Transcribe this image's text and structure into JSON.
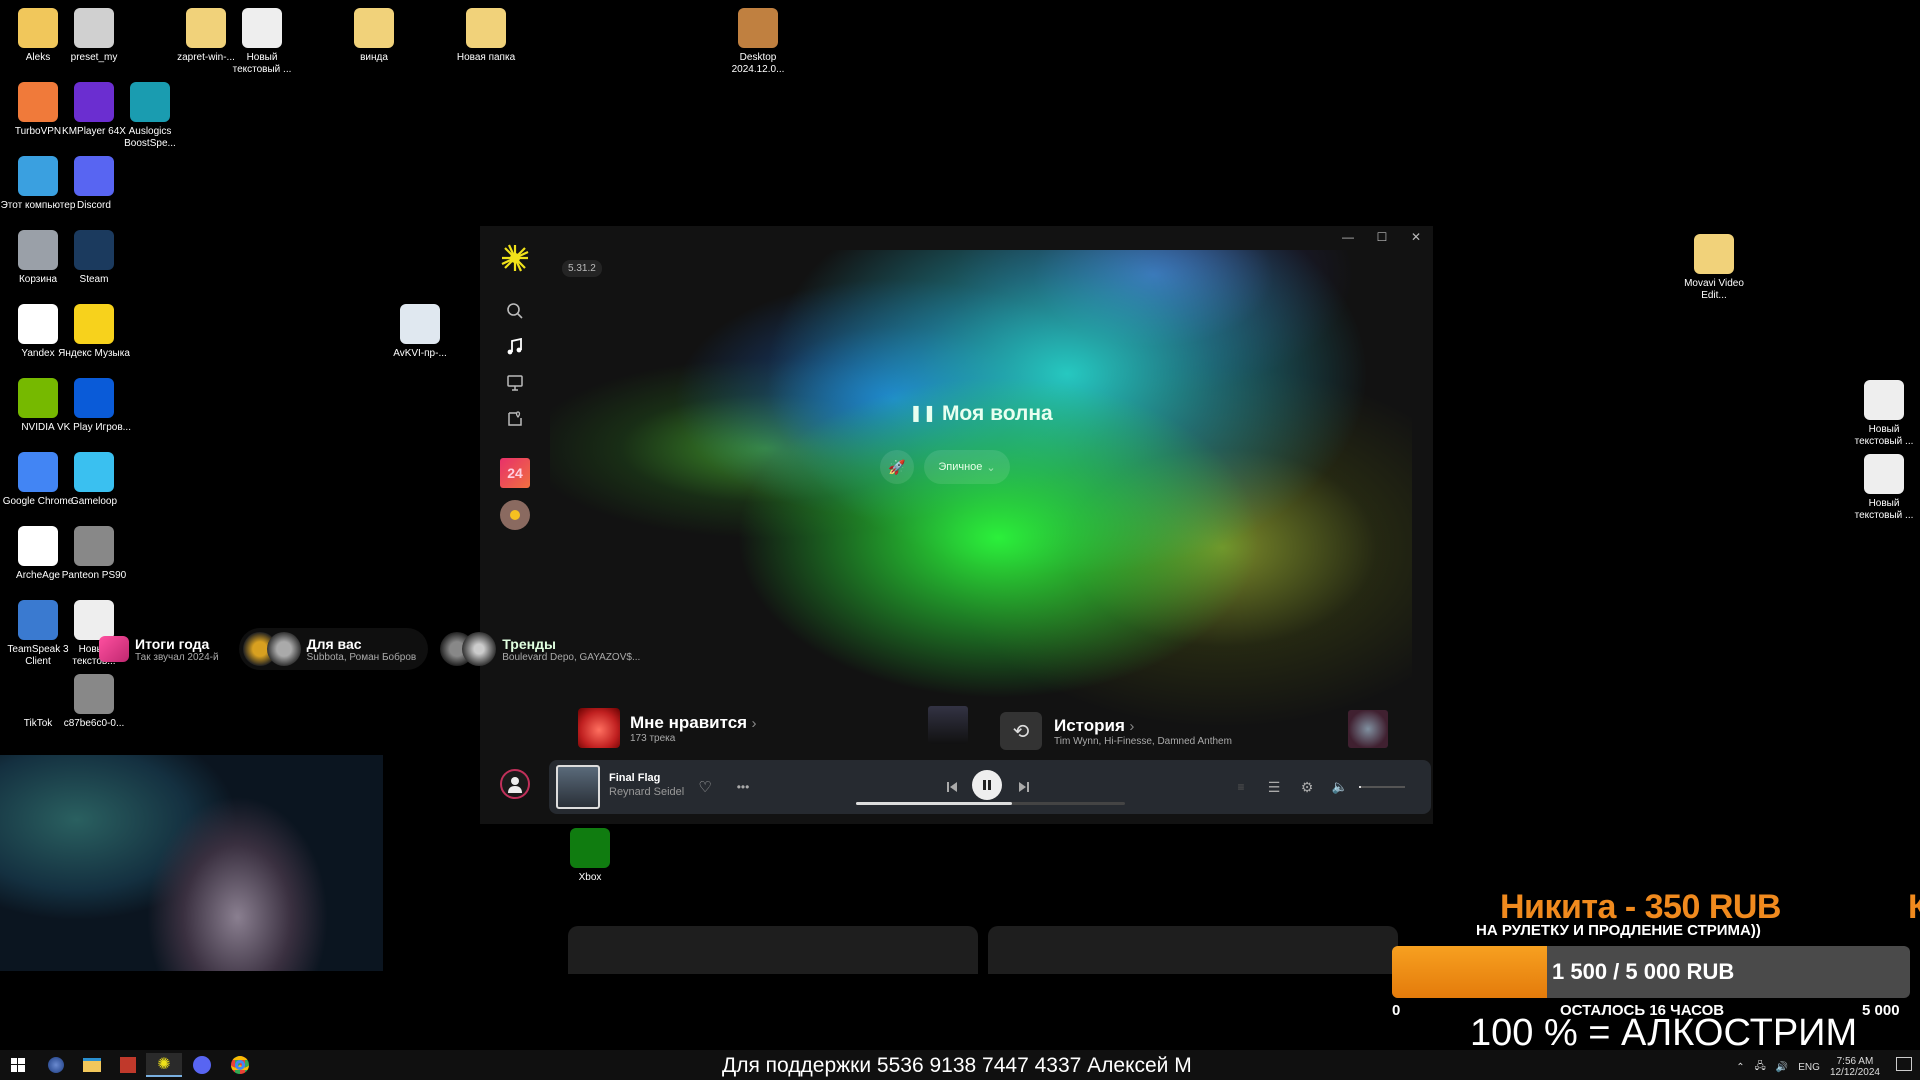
{
  "desktop_icons": [
    {
      "label": "Aleks",
      "icon": "user-folder-icon",
      "color": "#f1c75b"
    },
    {
      "label": "preset_my",
      "icon": "settings-file-icon",
      "color": "#d0d0d0"
    },
    {
      "label": "zapret-win-...",
      "icon": "folder-icon",
      "color": "#f1d27a"
    },
    {
      "label": "Новый текстовый ...",
      "icon": "text-file-icon",
      "color": "#eeeeee"
    },
    {
      "label": "винда",
      "icon": "folder-icon",
      "color": "#f1d27a"
    },
    {
      "label": "Новая папка",
      "icon": "folder-icon",
      "color": "#f1d27a"
    },
    {
      "label": "Desktop 2024.12.0...",
      "icon": "video-file-icon",
      "color": "#c08040"
    },
    {
      "label": "TurboVPN",
      "icon": "turbovpn-icon",
      "color": "#f07a3a"
    },
    {
      "label": "KMPlayer 64X",
      "icon": "kmplayer-icon",
      "color": "#6b2ed0"
    },
    {
      "label": "Auslogics BoostSpe...",
      "icon": "auslogics-icon",
      "color": "#1a9cb0"
    },
    {
      "label": "Этот компьютер",
      "icon": "computer-icon",
      "color": "#3aa0e0"
    },
    {
      "label": "Discord",
      "icon": "discord-icon",
      "color": "#5865f2"
    },
    {
      "label": "Корзина",
      "icon": "recycle-bin-icon",
      "color": "#9aa0a8"
    },
    {
      "label": "Steam",
      "icon": "steam-icon",
      "color": "#1b3a5e"
    },
    {
      "label": "Yandex",
      "icon": "yandex-browser-icon",
      "color": "#ffffff"
    },
    {
      "label": "Яндекс Музыка",
      "icon": "yandex-music-icon",
      "color": "#f7d21c"
    },
    {
      "label": "AvKVI-пр-...",
      "icon": "image-file-icon",
      "color": "#e0e8f0"
    },
    {
      "label": "NVIDIA",
      "icon": "nvidia-icon",
      "color": "#76b900"
    },
    {
      "label": "VK Play Игров...",
      "icon": "vkplay-icon",
      "color": "#0a5bd8"
    },
    {
      "label": "Google Chrome",
      "icon": "chrome-icon",
      "color": "#4285f4"
    },
    {
      "label": "Gameloop",
      "icon": "gameloop-icon",
      "color": "#3ac0f0"
    },
    {
      "label": "ArcheAge",
      "icon": "archeage-icon",
      "color": "#ffffff"
    },
    {
      "label": "Panteon PS90",
      "icon": "mouse-icon",
      "color": "#888888"
    },
    {
      "label": "TeamSpeak 3 Client",
      "icon": "teamspeak-icon",
      "color": "#3a7ad0"
    },
    {
      "label": "Новый текстов...",
      "icon": "text-file-icon",
      "color": "#eeeeee"
    },
    {
      "label": "TikTok",
      "icon": "tiktok-icon",
      "color": "#000000"
    },
    {
      "label": "c87be6c0-0...",
      "icon": "image-file-icon",
      "color": "#888888"
    },
    {
      "label": "Movavi Video Edit...",
      "icon": "folder-icon",
      "color": "#f1d27a"
    },
    {
      "label": "Новый текстовый ...",
      "icon": "text-file-icon",
      "color": "#eeeeee"
    },
    {
      "label": "Новый текстовый ...",
      "icon": "text-file-icon",
      "color": "#eeeeee"
    },
    {
      "label": "Xbox",
      "icon": "xbox-icon",
      "color": "#107c10"
    }
  ],
  "app": {
    "name": "Яндекс Музыка",
    "version": "5.31.2",
    "window_controls": {
      "minimize": "—",
      "maximize": "☐",
      "close": "✕"
    },
    "sidebar": [
      "search-icon",
      "music-note-icon",
      "podcasts-icon",
      "collection-icon",
      "year-summary-icon",
      "vinyl-icon"
    ],
    "hero": {
      "pause_glyph": "❚❚",
      "title": "Моя волна",
      "mood_label": "Эпичное",
      "mood_chevron": "⌄"
    },
    "shortcuts": [
      {
        "title": "Итоги года",
        "subtitle": "Так звучал 2024-й"
      },
      {
        "title": "Для вас",
        "subtitle": "Subbota, Роман Бобров"
      },
      {
        "title": "Тренды",
        "subtitle": "Boulevard Depo, GAYAZOV$..."
      }
    ],
    "cards": [
      {
        "title": "Мне нравится",
        "subtitle": "173 трека"
      },
      {
        "title": "История",
        "subtitle": "Tim Wynn, Hi-Finesse, Damned Anthem"
      }
    ],
    "player": {
      "track": "Final Flag",
      "artist": "Reynard Seidel",
      "progress": 0.58,
      "volume": 0.05,
      "state": "playing"
    }
  },
  "overlay": {
    "donation_name": "Никита - 350 RUB",
    "donation_trail": "К",
    "donation_message": "НА РУЛЕТКУ И ПРОДЛЕНИЕ СТРИМА))",
    "goal_current": 1500,
    "goal_target": 5000,
    "goal_text": "1 500 / 5 000 RUB",
    "goal_min": "0",
    "goal_max": "5 000",
    "goal_left": "ОСТАЛОСЬ 16 ЧАСОВ",
    "goal_condition": "100 % = АЛКОСТРИМ",
    "ticker": "Для поддержки 5536 9138 7447 4337 Алексей М"
  },
  "taskbar": {
    "pinned": [
      "windows-start-icon",
      "cortana-icon",
      "file-explorer-icon",
      "app-icon",
      "yandex-music-icon",
      "discord-icon",
      "chrome-icon"
    ],
    "language": "ENG",
    "time": "7:56 AM",
    "date": "12/12/2024"
  }
}
